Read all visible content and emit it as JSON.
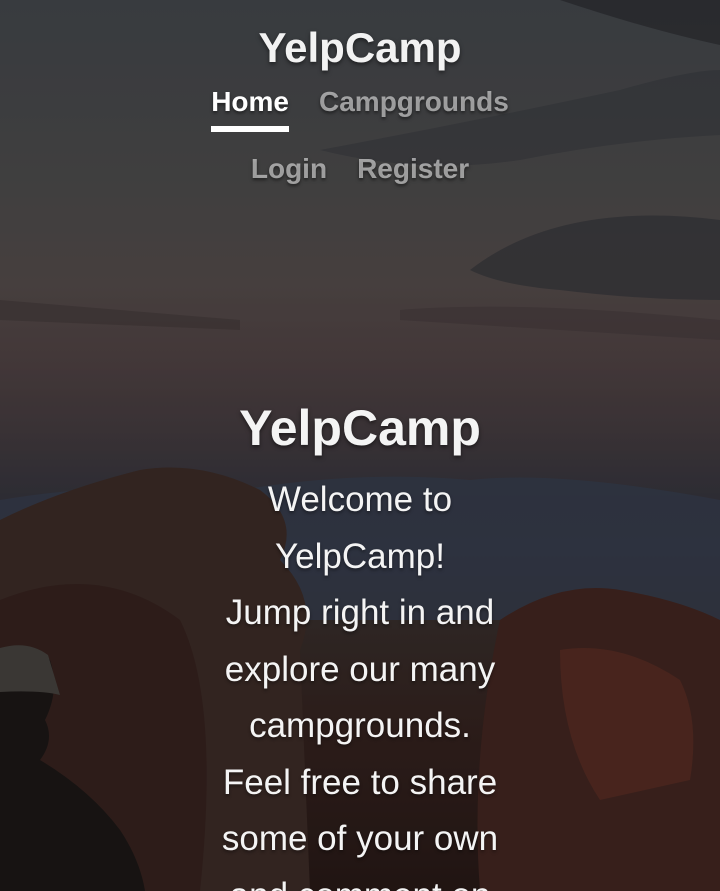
{
  "header": {
    "brand": "YelpCamp",
    "nav": {
      "home": "Home",
      "campgrounds": "Campgrounds",
      "login": "Login",
      "register": "Register"
    }
  },
  "hero": {
    "title": "YelpCamp",
    "lines": [
      "Welcome to",
      "YelpCamp!",
      "Jump right in and",
      "explore our many",
      "campgrounds.",
      "Feel free to share",
      "some of your own",
      "and comment on"
    ]
  }
}
